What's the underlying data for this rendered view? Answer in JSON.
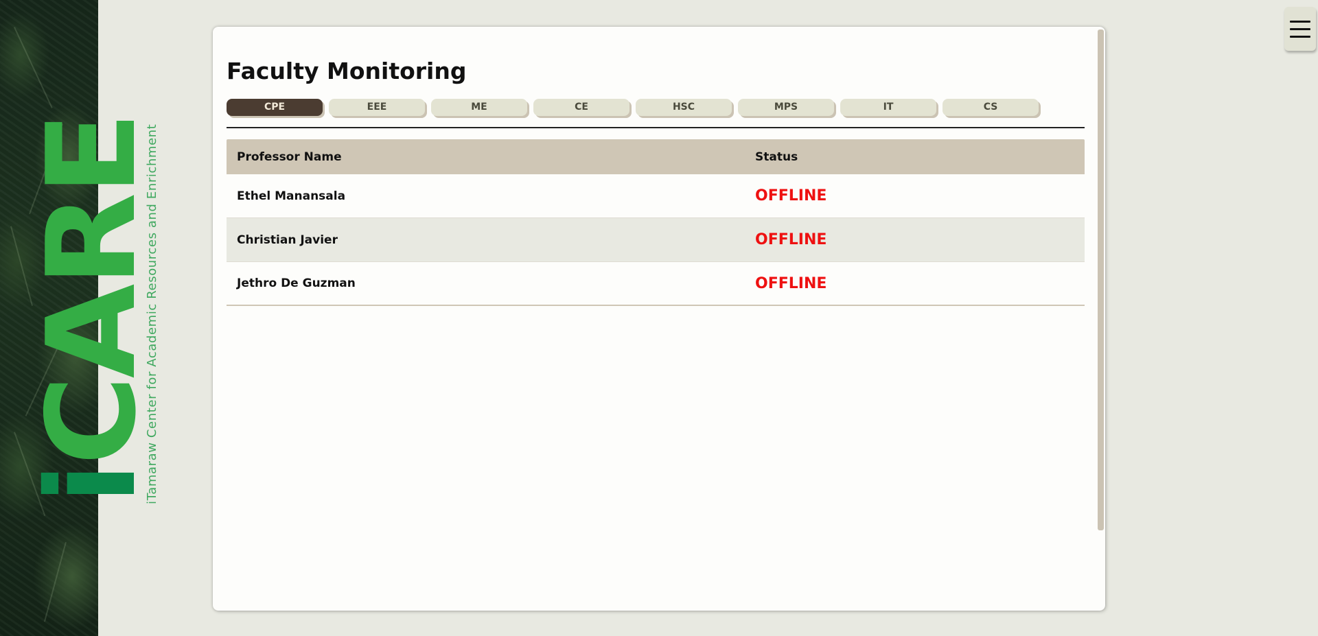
{
  "brand": {
    "logo_i": "i",
    "logo_rest": "CARE",
    "tagline": "iTamaraw Center for Academic Resources and Enrichment"
  },
  "page": {
    "title": "Faculty Monitoring"
  },
  "tabs": [
    {
      "label": "CPE",
      "active": true
    },
    {
      "label": "EEE",
      "active": false
    },
    {
      "label": "ME",
      "active": false
    },
    {
      "label": "CE",
      "active": false
    },
    {
      "label": "HSC",
      "active": false
    },
    {
      "label": "MPS",
      "active": false
    },
    {
      "label": "IT",
      "active": false
    },
    {
      "label": "CS",
      "active": false
    }
  ],
  "table": {
    "headers": {
      "name": "Professor Name",
      "status": "Status"
    },
    "rows": [
      {
        "name": "Ethel Manansala",
        "status": "OFFLINE"
      },
      {
        "name": "Christian Javier",
        "status": "OFFLINE"
      },
      {
        "name": "Jethro De Guzman",
        "status": "OFFLINE"
      }
    ]
  },
  "colors": {
    "accent_green": "#34ad45",
    "offline_red": "#ee1111",
    "active_tab": "#4b3c31",
    "header_bg": "#cfc6b5",
    "page_bg": "#e8e9e1"
  },
  "icons": {
    "menu": "hamburger-menu-icon"
  }
}
